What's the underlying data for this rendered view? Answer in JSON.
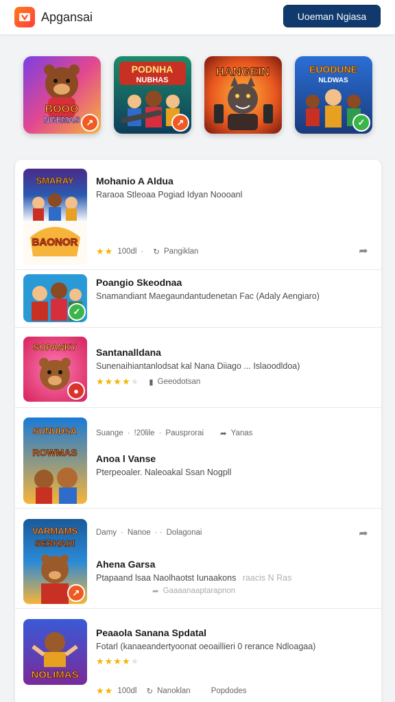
{
  "header": {
    "app_title": "Apgansai",
    "cta_label": "Uoeman Ngiasa",
    "logo_icon": "store-logo-icon"
  },
  "colors": {
    "cta_bg": "#103a6e",
    "star": "#f5b400",
    "badge_orange": "#f05a22",
    "badge_green": "#3bb54a"
  },
  "featured": [
    {
      "art_text": [
        "BOOO",
        "NGEMAS"
      ],
      "badge": "orange",
      "badge_icon": "arrow-icon"
    },
    {
      "art_text": [
        "PODNHA",
        "NUBHAS"
      ],
      "badge": "orange",
      "badge_icon": "arrow-icon"
    },
    {
      "art_text": [
        "HANGEIN",
        ""
      ],
      "badge": "none",
      "badge_icon": ""
    },
    {
      "art_text": [
        "EUODUNE",
        "NLDWAS"
      ],
      "badge": "green",
      "badge_icon": "check-icon"
    }
  ],
  "list": [
    {
      "title": "Mohanio A Aldua",
      "subtitle": "Raraoa Stleoaa Pogiad Idyan Noooanl",
      "rating": "★★",
      "rating_off": "",
      "count": "100dl",
      "dot1": "·",
      "meta_label": "Pangiklan",
      "art_top": "SMARAY",
      "art_bottom": "BAONOR"
    },
    {
      "title": "Poangio Skeodnaa",
      "subtitle": "Snamandiant Maegaundantudenetan Fac (Adaly Aengiaro)",
      "art_top": "",
      "art_bottom": ""
    },
    {
      "title": "Santanalldana",
      "subtitle": "Sunenaihiantanlodsat kal Nana Diiago ... Islaoodldoa)",
      "rating": "★★★★",
      "rating_off": "★",
      "meta_label": "Geeodotsan",
      "art_top": "SOPANKY",
      "art_bottom": ""
    },
    {
      "pre_meta_1": "Suange",
      "pre_meta_2": "!20lile",
      "pre_meta_3": "Pausprorai",
      "pre_meta_4": "Yanas",
      "dot1": "·",
      "title": "Anoa l Vanse",
      "subtitle": "Pterpeoaler. Naleoakal Ssan Nogpll",
      "art_top": "SUNUDSA",
      "art_bottom": "ROWMAS"
    },
    {
      "pre_meta_1": "Damy",
      "pre_meta_2": "Nanoe",
      "pre_meta_3": "Dolagonai",
      "dot1": "·",
      "dot2": "· ·",
      "title": "Ahena Garsa",
      "subtitle": "Ptapaand lsaa Naolhaotst Iunaakons",
      "subtitle_faint": "raacis N Ras",
      "meta_label": "Gaaaanaaptarapnon",
      "art_top": "VARMAMS",
      "art_bottom": "SEBHADI"
    },
    {
      "title": "Peaaola Sanana Spdatal",
      "subtitle": "Fotarl (kanaeandertyoonat oeoaillieri 0 rerance Ndloagaa)",
      "rating": "★★★★",
      "rating_off": "★",
      "rating2": "★★",
      "count2": "100dl",
      "meta_label2": "Nanoklan",
      "meta_label3": "Popdodes",
      "art_top": "",
      "art_bottom": "NOLIMAS"
    }
  ]
}
